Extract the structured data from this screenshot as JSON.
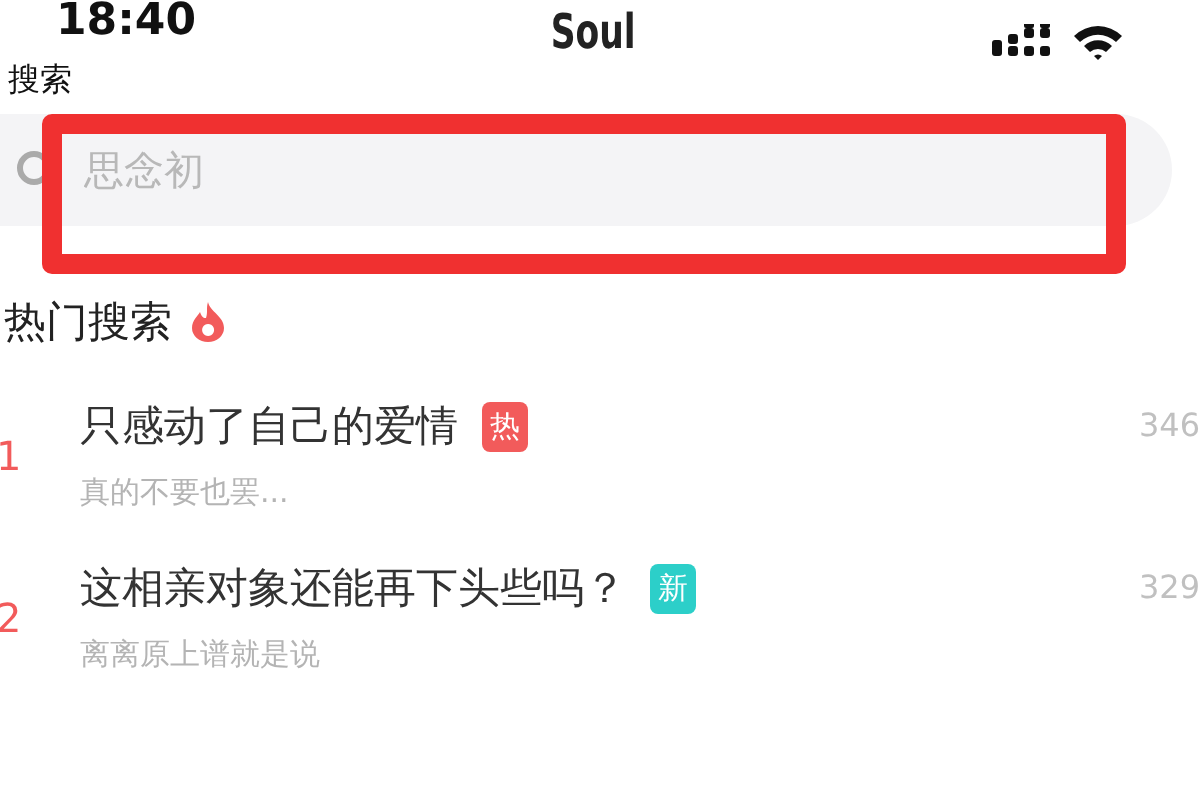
{
  "status_bar": {
    "time": "18:40",
    "app_name": "Soul"
  },
  "page_title": "搜索",
  "search": {
    "placeholder": "思念初"
  },
  "annotation": {
    "color": "#f03030"
  },
  "hot_searches": {
    "title": "热门搜索",
    "items": [
      {
        "rank": "1",
        "title": "只感动了自己的爱情",
        "tag": "热",
        "color": "#f25b5b",
        "subtitle": "真的不要也罢...",
        "count": "346"
      },
      {
        "rank": "2",
        "title": "这相亲对象还能再下头些吗？",
        "tag": "新",
        "color": "#2ccfc9",
        "subtitle": "离离原上谱就是说",
        "count": "329"
      }
    ]
  }
}
